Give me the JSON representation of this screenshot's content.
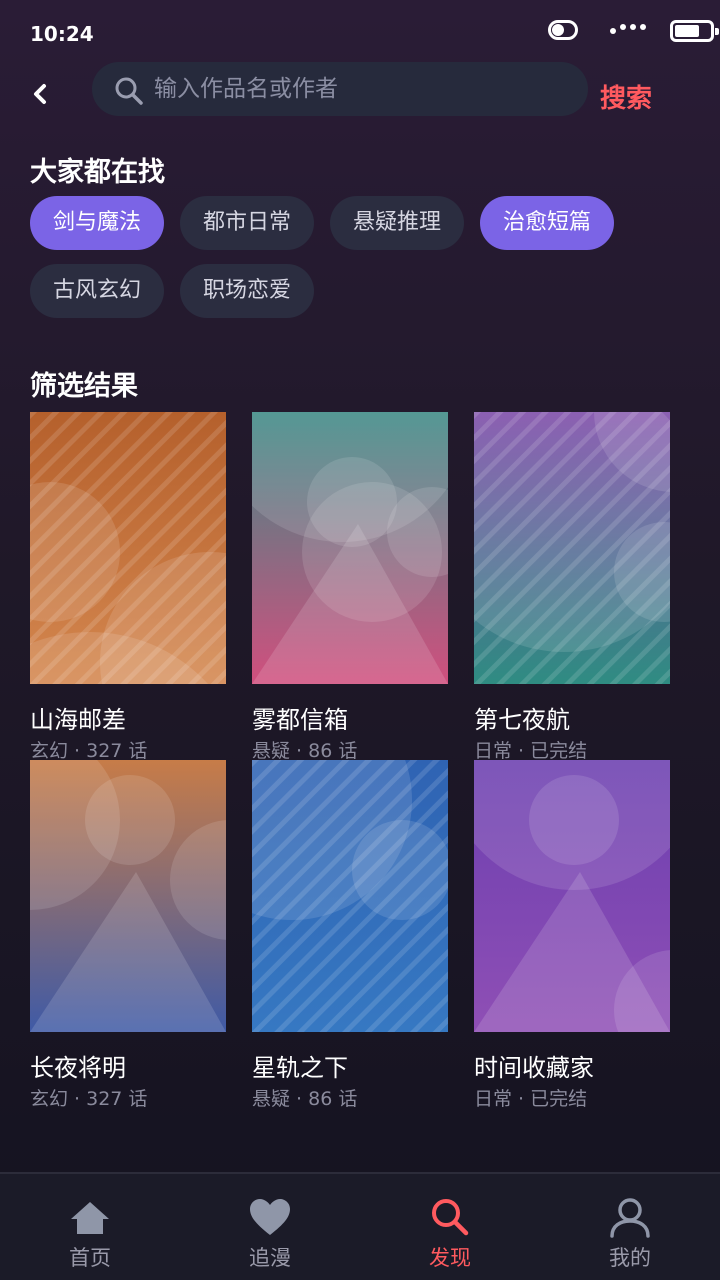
{
  "status_bar": {
    "time": "10:24"
  },
  "search": {
    "placeholder": "输入作品名或作者",
    "value": "",
    "submit_label": "搜索"
  },
  "hot_section": {
    "title": "大家都在找",
    "tags": [
      {
        "label": "剑与魔法",
        "active": true
      },
      {
        "label": "都市日常",
        "active": false
      },
      {
        "label": "悬疑推理",
        "active": false
      },
      {
        "label": "治愈短篇",
        "active": true
      },
      {
        "label": "古风玄幻",
        "active": false
      },
      {
        "label": "职场恋爱",
        "active": false
      }
    ]
  },
  "results_section": {
    "title": "筛选结果",
    "items": [
      {
        "title": "山海邮差",
        "meta": "玄幻 · 327 话",
        "cover": [
          "#b5602c",
          "#d4874f"
        ]
      },
      {
        "title": "雾都信箱",
        "meta": "悬疑 · 86 话",
        "cover": [
          "#3d8a86",
          "#d14f7e"
        ]
      },
      {
        "title": "第七夜航",
        "meta": "日常 · 已完结",
        "cover": [
          "#7c4aa8",
          "#2f8c82"
        ]
      },
      {
        "title": "长夜将明",
        "meta": "玄幻 · 327 话",
        "cover": [
          "#c77c48",
          "#3f5aa6"
        ]
      },
      {
        "title": "星轨之下",
        "meta": "悬疑 · 86 话",
        "cover": [
          "#2f63b3",
          "#3678c2"
        ]
      },
      {
        "title": "时间收藏家",
        "meta": "日常 · 已完结",
        "cover": [
          "#6c3fb0",
          "#8f4fb5"
        ]
      }
    ]
  },
  "bottom_nav": {
    "items": [
      {
        "label": "首页",
        "icon": "home-icon",
        "active": false
      },
      {
        "label": "追漫",
        "icon": "heart-icon",
        "active": false
      },
      {
        "label": "发现",
        "icon": "search-icon",
        "active": true
      },
      {
        "label": "我的",
        "icon": "profile-icon",
        "active": false
      }
    ]
  },
  "colors": {
    "accent": "#ff5a5f",
    "tag_active": "#7b64e6",
    "tag_inactive": "#2b2d40"
  }
}
